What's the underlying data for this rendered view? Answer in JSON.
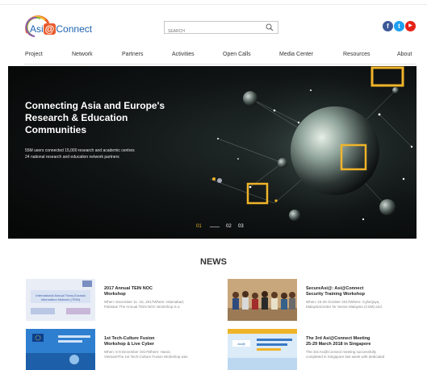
{
  "header": {
    "logo": {
      "brand_text_1": "Asi",
      "brand_highlight": "@",
      "brand_text_2": "Connect"
    },
    "search": {
      "placeholder": "SEARCH"
    },
    "social": [
      {
        "icon": "facebook-icon",
        "glyph": "f",
        "color": "#3b5998"
      },
      {
        "icon": "twitter-icon",
        "glyph": "t",
        "color": "#1da1f2"
      },
      {
        "icon": "youtube-icon",
        "glyph": "▶",
        "color": "#e62117"
      }
    ]
  },
  "nav": {
    "items": [
      {
        "label": "Project"
      },
      {
        "label": "Network"
      },
      {
        "label": "Partners"
      },
      {
        "label": "Activities"
      },
      {
        "label": "Open Calls"
      },
      {
        "label": "Media Center"
      },
      {
        "label": "Resources"
      },
      {
        "label": "About"
      }
    ]
  },
  "hero": {
    "title_lines": [
      "Connecting Asia and Europe's",
      "Research & Education",
      "Communities"
    ],
    "sub_lines": [
      "55M users connected 15,000 research and academic centres",
      "24 national research and education network partners"
    ],
    "slides": [
      "01",
      "02",
      "03"
    ],
    "active_slide": "01"
  },
  "news": {
    "heading": "NEWS",
    "items": [
      {
        "title_lines": [
          "2017 Annual TEIN NOC",
          "Workshop"
        ],
        "desc_lines": [
          "When: December 11 -15, 2017Where: Islamabad,",
          "Pakistan The Annual TEIN NOC Workshop is a"
        ]
      },
      {
        "title_lines": [
          "SecureAsi@: Asi@Connect",
          "Security Training Workshop"
        ],
        "desc_lines": [
          "When: 23-25 October 2017Where: Cyberjaya,",
          "MalaysiaCenter for Sense Malaysia (CSM) and"
        ]
      },
      {
        "title_lines": [
          "1st Tech-Culture Fusion",
          "Workshop & Live Cyber"
        ],
        "desc_lines": [
          "When: 6-8 December 2017Where: Hanoi,",
          "VietnamThe 1st Tech-Culture Fusion Workshop was"
        ]
      },
      {
        "title_lines": [
          "The 3rd Asi@Connect Meeting",
          "25-29 March 2018 in Singapore"
        ],
        "desc_lines": [
          "The 3rd Asi@Connect meeting successfully",
          "completed in Singapore last week with dedicated"
        ]
      }
    ]
  },
  "colors": {
    "accent": "#f0b429",
    "brand_blue": "#1e63b0",
    "brand_orange": "#ea5a2a",
    "hero_bg": "#0b0e0e"
  }
}
